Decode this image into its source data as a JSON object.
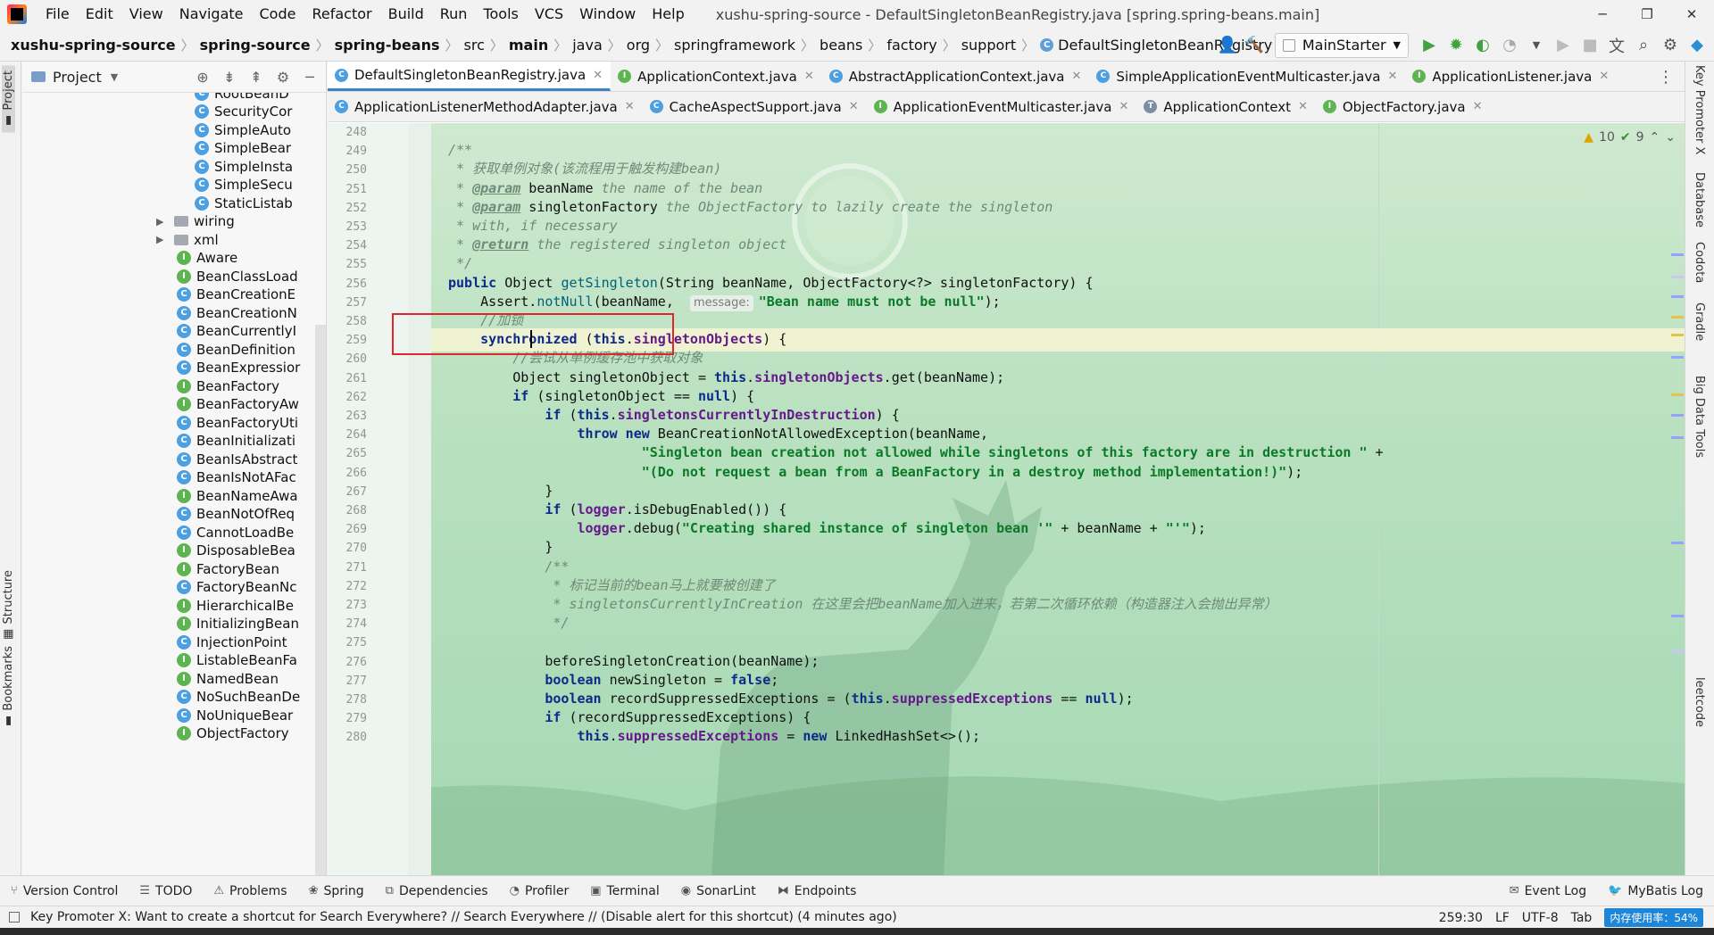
{
  "window": {
    "title": "xushu-spring-source - DefaultSingletonBeanRegistry.java [spring.spring-beans.main]",
    "controls": {
      "minimize": "─",
      "restore": "❐",
      "close": "✕"
    }
  },
  "menu": [
    "File",
    "Edit",
    "View",
    "Navigate",
    "Code",
    "Refactor",
    "Build",
    "Run",
    "Tools",
    "VCS",
    "Window",
    "Help"
  ],
  "breadcrumb": [
    "xushu-spring-source",
    "spring-source",
    "spring-beans",
    "src",
    "main",
    "java",
    "org",
    "springframework",
    "beans",
    "factory",
    "support",
    "DefaultSingletonBeanRegistry",
    "getSingleton"
  ],
  "toolbar": {
    "run_config": "MainStarter"
  },
  "left_stripe": {
    "project": "Project",
    "structure": "Structure",
    "bookmarks": "Bookmarks"
  },
  "project_panel": {
    "title": "Project",
    "tree": [
      {
        "name": "RootBeanD",
        "kind": "c",
        "indent": 1
      },
      {
        "name": "SecurityCor",
        "kind": "c",
        "indent": 1
      },
      {
        "name": "SimpleAuto",
        "kind": "c",
        "indent": 1
      },
      {
        "name": "SimpleBear",
        "kind": "c",
        "indent": 1
      },
      {
        "name": "SimpleInsta",
        "kind": "c",
        "indent": 1
      },
      {
        "name": "SimpleSecu",
        "kind": "c",
        "indent": 1
      },
      {
        "name": "StaticListab",
        "kind": "c",
        "indent": 1
      },
      {
        "name": "wiring",
        "kind": "folder",
        "indent": 0
      },
      {
        "name": "xml",
        "kind": "folder",
        "indent": 0
      },
      {
        "name": "Aware",
        "kind": "i",
        "indent": 0
      },
      {
        "name": "BeanClassLoad",
        "kind": "i",
        "indent": 0
      },
      {
        "name": "BeanCreationE",
        "kind": "c",
        "indent": 0
      },
      {
        "name": "BeanCreationN",
        "kind": "c",
        "indent": 0
      },
      {
        "name": "BeanCurrentlyI",
        "kind": "c",
        "indent": 0
      },
      {
        "name": "BeanDefinition",
        "kind": "c",
        "indent": 0
      },
      {
        "name": "BeanExpressior",
        "kind": "c",
        "indent": 0
      },
      {
        "name": "BeanFactory",
        "kind": "i",
        "indent": 0
      },
      {
        "name": "BeanFactoryAw",
        "kind": "i",
        "indent": 0
      },
      {
        "name": "BeanFactoryUti",
        "kind": "c",
        "indent": 0
      },
      {
        "name": "BeanInitializati",
        "kind": "c",
        "indent": 0
      },
      {
        "name": "BeanIsAbstract",
        "kind": "c",
        "indent": 0
      },
      {
        "name": "BeanIsNotAFac",
        "kind": "c",
        "indent": 0
      },
      {
        "name": "BeanNameAwa",
        "kind": "i",
        "indent": 0
      },
      {
        "name": "BeanNotOfReq",
        "kind": "c",
        "indent": 0
      },
      {
        "name": "CannotLoadBe",
        "kind": "c",
        "indent": 0
      },
      {
        "name": "DisposableBea",
        "kind": "i",
        "indent": 0
      },
      {
        "name": "FactoryBean",
        "kind": "i",
        "indent": 0
      },
      {
        "name": "FactoryBeanNc",
        "kind": "c",
        "indent": 0
      },
      {
        "name": "HierarchicalBe",
        "kind": "i",
        "indent": 0
      },
      {
        "name": "InitializingBean",
        "kind": "i",
        "indent": 0
      },
      {
        "name": "InjectionPoint",
        "kind": "c",
        "indent": 0
      },
      {
        "name": "ListableBeanFa",
        "kind": "i",
        "indent": 0
      },
      {
        "name": "NamedBean",
        "kind": "i",
        "indent": 0
      },
      {
        "name": "NoSuchBeanDe",
        "kind": "c",
        "indent": 0
      },
      {
        "name": "NoUniqueBear",
        "kind": "c",
        "indent": 0
      },
      {
        "name": "ObjectFactory",
        "kind": "i",
        "indent": 0
      }
    ]
  },
  "tabs_row1": [
    {
      "label": "DefaultSingletonBeanRegistry.java",
      "icon": "c",
      "active": true
    },
    {
      "label": "ApplicationContext.java",
      "icon": "i",
      "active": false
    },
    {
      "label": "AbstractApplicationContext.java",
      "icon": "c",
      "active": false
    },
    {
      "label": "SimpleApplicationEventMulticaster.java",
      "icon": "c",
      "active": false
    },
    {
      "label": "ApplicationListener.java",
      "icon": "i",
      "active": false
    }
  ],
  "tabs_row2": [
    {
      "label": "ApplicationListenerMethodAdapter.java",
      "icon": "c",
      "active": false
    },
    {
      "label": "CacheAspectSupport.java",
      "icon": "c",
      "active": false
    },
    {
      "label": "ApplicationEventMulticaster.java",
      "icon": "i",
      "active": false
    },
    {
      "label": "ApplicationContext",
      "icon": "t",
      "active": false
    },
    {
      "label": "ObjectFactory.java",
      "icon": "i",
      "active": false
    }
  ],
  "inspections": {
    "warnings": "10",
    "checks": "9"
  },
  "code": {
    "first_line": 248,
    "lines": [
      [],
      [
        [
          "doc",
          "/**"
        ]
      ],
      [
        [
          "doc",
          " * 获取单例对象(该流程用于触发构建bean)"
        ]
      ],
      [
        [
          "doc",
          " * "
        ],
        [
          "tag",
          "@param"
        ],
        [
          "plain",
          " beanName"
        ],
        [
          "doc",
          " the name of the bean"
        ]
      ],
      [
        [
          "doc",
          " * "
        ],
        [
          "tag",
          "@param"
        ],
        [
          "plain",
          " singletonFactory"
        ],
        [
          "doc",
          " the ObjectFactory to lazily create the singleton"
        ]
      ],
      [
        [
          "doc",
          " * with, if necessary"
        ]
      ],
      [
        [
          "doc",
          " * "
        ],
        [
          "tag",
          "@return"
        ],
        [
          "doc",
          " the registered singleton object"
        ]
      ],
      [
        [
          "doc",
          " */"
        ]
      ],
      [
        [
          "kw",
          "public"
        ],
        [
          "plain",
          " Object "
        ],
        [
          "mth",
          "getSingleton"
        ],
        [
          "plain",
          "(String beanName, ObjectFactory<?> singletonFactory) {"
        ]
      ],
      [
        [
          "plain",
          "    Assert."
        ],
        [
          "mth",
          "notNull"
        ],
        [
          "plain",
          "(beanName,  "
        ],
        [
          "hint",
          "message:"
        ],
        [
          "str",
          "\"Bean name must not be null\""
        ],
        [
          "plain",
          ");"
        ]
      ],
      [
        [
          "cmt",
          "    //加锁"
        ]
      ],
      [
        [
          "kw",
          "    synchronized"
        ],
        [
          "plain",
          " ("
        ],
        [
          "kw",
          "this"
        ],
        [
          "plain",
          "."
        ],
        [
          "fld",
          "singletonObjects"
        ],
        [
          "plain",
          ") {"
        ]
      ],
      [
        [
          "cmt",
          "        //尝试从单例缓存池中获取对象"
        ]
      ],
      [
        [
          "plain",
          "        Object singletonObject = "
        ],
        [
          "kw",
          "this"
        ],
        [
          "plain",
          "."
        ],
        [
          "fld",
          "singletonObjects"
        ],
        [
          "plain",
          ".get(beanName);"
        ]
      ],
      [
        [
          "kw",
          "        if"
        ],
        [
          "plain",
          " (singletonObject == "
        ],
        [
          "kw",
          "null"
        ],
        [
          "plain",
          ") {"
        ]
      ],
      [
        [
          "kw",
          "            if"
        ],
        [
          "plain",
          " ("
        ],
        [
          "kw",
          "this"
        ],
        [
          "plain",
          "."
        ],
        [
          "fld",
          "singletonsCurrentlyInDestruction"
        ],
        [
          "plain",
          ") {"
        ]
      ],
      [
        [
          "kw",
          "                throw new"
        ],
        [
          "plain",
          " BeanCreationNotAllowedException(beanName,"
        ]
      ],
      [
        [
          "str",
          "                        \"Singleton bean creation not allowed while singletons of this factory are in destruction \""
        ],
        [
          "plain",
          " +"
        ]
      ],
      [
        [
          "str",
          "                        \"(Do not request a bean from a BeanFactory in a destroy method implementation!)\""
        ],
        [
          "plain",
          ");"
        ]
      ],
      [
        [
          "plain",
          "            }"
        ]
      ],
      [
        [
          "kw",
          "            if"
        ],
        [
          "plain",
          " ("
        ],
        [
          "fld",
          "logger"
        ],
        [
          "plain",
          ".isDebugEnabled()) {"
        ]
      ],
      [
        [
          "fld",
          "                logger"
        ],
        [
          "plain",
          ".debug("
        ],
        [
          "str",
          "\"Creating shared instance of singleton bean '\""
        ],
        [
          "plain",
          " + beanName + "
        ],
        [
          "str",
          "\"'\""
        ],
        [
          "plain",
          ");"
        ]
      ],
      [
        [
          "plain",
          "            }"
        ]
      ],
      [
        [
          "doc",
          "            /**"
        ]
      ],
      [
        [
          "doc",
          "             * 标记当前的bean马上就要被创建了"
        ]
      ],
      [
        [
          "doc",
          "             * singletonsCurrentlyInCreation 在这里会把beanName加入进来，若第二次循环依赖（构造器注入会抛出异常）"
        ]
      ],
      [
        [
          "doc",
          "             */"
        ]
      ],
      [],
      [
        [
          "plain",
          "            beforeSingletonCreation(beanName);"
        ]
      ],
      [
        [
          "kw",
          "            boolean"
        ],
        [
          "plain",
          " newSingleton = "
        ],
        [
          "kw",
          "false"
        ],
        [
          "plain",
          ";"
        ]
      ],
      [
        [
          "kw",
          "            boolean"
        ],
        [
          "plain",
          " recordSuppressedExceptions = ("
        ],
        [
          "kw",
          "this"
        ],
        [
          "plain",
          "."
        ],
        [
          "fld",
          "suppressedExceptions"
        ],
        [
          "plain",
          " == "
        ],
        [
          "kw",
          "null"
        ],
        [
          "plain",
          ");"
        ]
      ],
      [
        [
          "kw",
          "            if"
        ],
        [
          "plain",
          " (recordSuppressedExceptions) {"
        ]
      ],
      [
        [
          "kw",
          "                this"
        ],
        [
          "plain",
          "."
        ],
        [
          "fld",
          "suppressedExceptions"
        ],
        [
          "plain",
          " = "
        ],
        [
          "kw",
          "new"
        ],
        [
          "plain",
          " LinkedHashSet<>();"
        ]
      ]
    ]
  },
  "right_stripe": [
    "Key Promoter X",
    "Database",
    "Codota",
    "Gradle",
    "Big Data Tools",
    "leetcode"
  ],
  "bottom_tools": [
    "Version Control",
    "TODO",
    "Problems",
    "Spring",
    "Dependencies",
    "Profiler",
    "Terminal",
    "SonarLint",
    "Endpoints",
    "Event Log",
    "MyBatis Log"
  ],
  "status": {
    "message": "Key Promoter X: Want to create a shortcut for Search Everywhere? // Search Everywhere // (Disable alert for this shortcut) (4 minutes ago)",
    "position": "259:30",
    "line_sep": "LF",
    "encoding": "UTF-8",
    "indent": "Tab",
    "memory": "内存使用率：54%"
  }
}
